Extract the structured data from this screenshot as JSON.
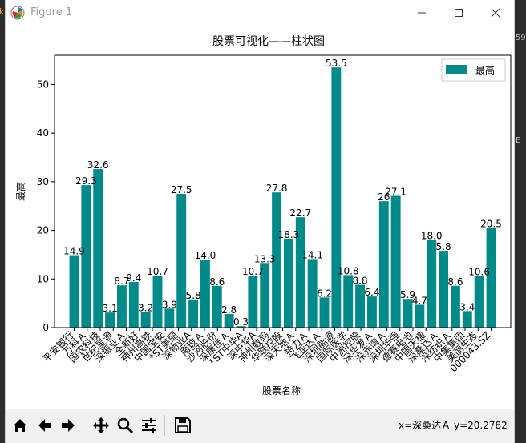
{
  "window": {
    "title": "Figure 1"
  },
  "status": {
    "readout": "x=深桑达Ａ y=20.2782"
  },
  "colors": {
    "bar": "#008B8A",
    "axes": "#000000"
  },
  "toolbar": {
    "buttons": [
      "home-icon",
      "back-arrow-icon",
      "forward-arrow-icon",
      "pan-icon",
      "zoom-icon",
      "configure-subplots-icon",
      "save-icon"
    ]
  },
  "chart_data": {
    "type": "bar",
    "title": "股票可视化——柱状图",
    "xlabel": "股票名称",
    "ylabel": "最高",
    "ylim": [
      0,
      56
    ],
    "yticks": [
      0,
      10,
      20,
      30,
      40,
      50
    ],
    "legend": {
      "position": "top-right",
      "entries": [
        "最高"
      ]
    },
    "grid": false,
    "categories": [
      "平安银行",
      "万科Ａ",
      "国农科技",
      "世纪星源",
      "深振业Ａ",
      "全新好",
      "神州高铁",
      "中国宝安",
      "*ST美丽",
      "深物业A",
      "南玻Ａ",
      "沙河股份",
      "深康佳Ａ",
      "*ST中华A",
      "深中华A",
      "神州数码",
      "华联控股",
      "深天地Ａ",
      "特力Ａ",
      "飞亚达Ａ",
      "深圳能源",
      "国际医学",
      "中洲控股",
      "深华发Ａ",
      "深赤湾Ａ",
      "深圳华强",
      "德赛电池",
      "中国天楹",
      "深桑达Ａ",
      "深纺织Ａ",
      "中集集团",
      "美丽生态",
      "000043.SZ"
    ],
    "series": [
      {
        "name": "最高",
        "values": [
          14.9,
          29.3,
          32.6,
          3.1,
          8.7,
          9.4,
          3.2,
          10.7,
          3.9,
          27.5,
          5.8,
          14.0,
          8.6,
          2.8,
          0.3,
          10.7,
          13.3,
          27.8,
          18.3,
          22.7,
          14.1,
          6.2,
          53.5,
          10.8,
          8.8,
          6.4,
          26.0,
          27.1,
          5.9,
          4.7,
          18.0,
          15.8,
          8.6,
          3.4,
          10.6,
          20.5
        ],
        "labels": [
          "14.9",
          "29.3",
          "32.6",
          "3.1",
          "8.7",
          "9.4",
          "3.2",
          "10.7",
          "3.9",
          "27.5",
          "5.8",
          "14.0",
          "8.6",
          "2.8",
          "0.3",
          "10.7",
          "13.3",
          "27.8",
          "18.3",
          "22.7",
          "14.1",
          "6.2",
          "53.5",
          "10.8",
          "8.8",
          "6.4",
          "26",
          "27.1",
          "5.9",
          "4.7",
          "18.0",
          "5.8",
          "8.6",
          "3.4",
          "10.6",
          "20.5"
        ]
      }
    ]
  }
}
